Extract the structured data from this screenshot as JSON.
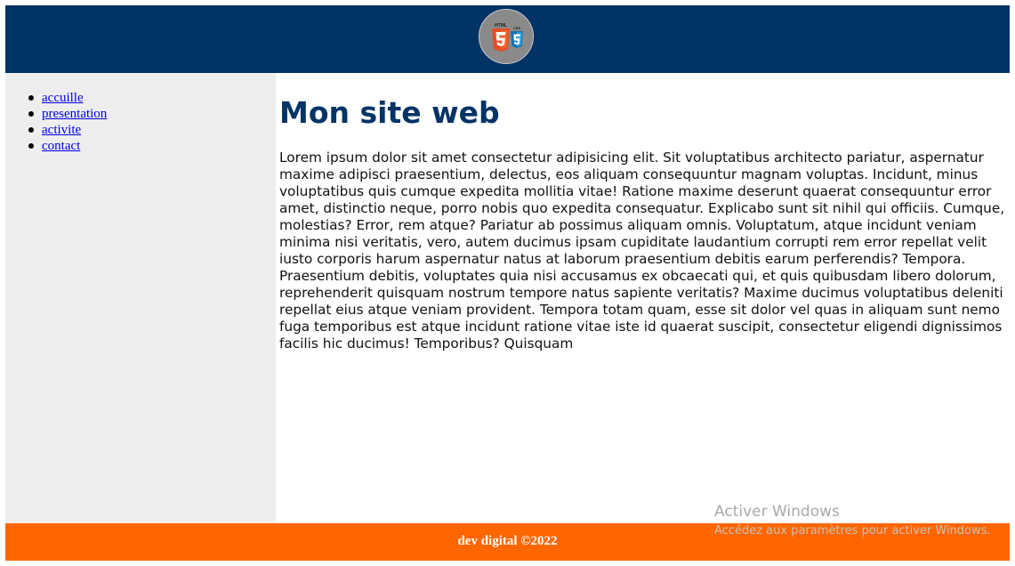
{
  "colors": {
    "header_bg": "#003366",
    "footer_bg": "#ff6600",
    "sidebar_bg": "#eeeeee",
    "title": "#003366"
  },
  "logo": {
    "icon": "html5-css3-logo-icon",
    "html_label": "HTML",
    "css_label": "CSS"
  },
  "sidebar": {
    "items": [
      {
        "label": "accuille"
      },
      {
        "label": "presentation"
      },
      {
        "label": "activite"
      },
      {
        "label": "contact"
      }
    ]
  },
  "main": {
    "title": "Mon site web",
    "paragraph": "Lorem ipsum dolor sit amet consectetur adipisicing elit. Sit voluptatibus architecto pariatur, aspernatur maxime adipisci praesentium, delectus, eos aliquam consequuntur magnam voluptas. Incidunt, minus voluptatibus quis cumque expedita mollitia vitae! Ratione maxime deserunt quaerat consequuntur error amet, distinctio neque, porro nobis quo expedita consequatur. Explicabo sunt sit nihil qui officiis. Cumque, molestias? Error, rem atque? Pariatur ab possimus aliquam omnis. Voluptatum, atque incidunt veniam minima nisi veritatis, vero, autem ducimus ipsam cupiditate laudantium corrupti rem error repellat velit iusto corporis harum aspernatur natus at laborum praesentium debitis earum perferendis? Tempora. Praesentium debitis, voluptates quia nisi accusamus ex obcaecati qui, et quis quibusdam libero dolorum, reprehenderit quisquam nostrum tempore natus sapiente veritatis? Maxime ducimus voluptatibus deleniti repellat eius atque veniam provident. Tempora totam quam, esse sit dolor vel quas in aliquam sunt nemo fuga temporibus est atque incidunt ratione vitae iste id quaerat suscipit, consectetur eligendi dignissimos facilis hic ducimus! Temporibus? Quisquam"
  },
  "footer": {
    "text": "dev digital ©2022"
  },
  "watermark": {
    "title": "Activer Windows",
    "subtitle": "Accédez aux paramètres pour activer Windows."
  }
}
